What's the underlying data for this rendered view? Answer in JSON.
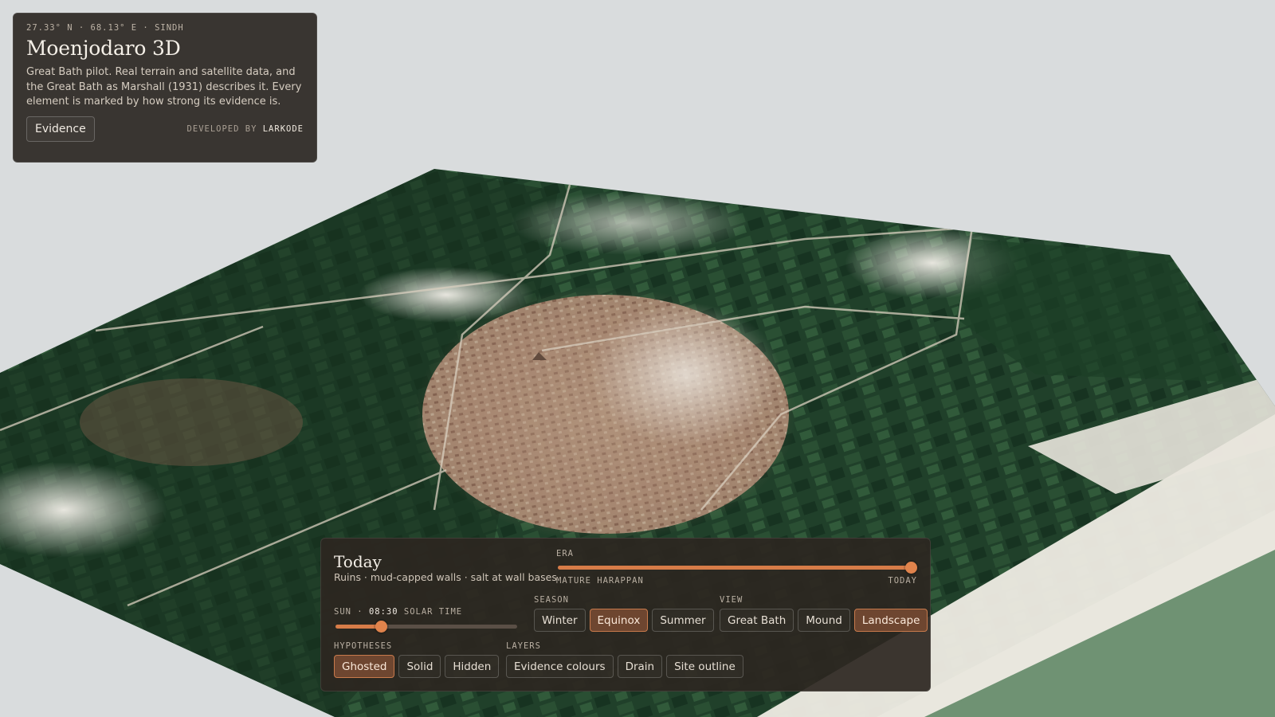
{
  "site": {
    "coordinates": "27.33° N · 68.13° E · SINDH",
    "title": "Moenjodaro 3D",
    "description": "Great Bath pilot. Real terrain and satellite data, and the Great Bath as Marshall (1931) describes it. Every element is marked by how strong its evidence is.",
    "evidence_label": "Evidence",
    "developed_by_label": "DEVELOPED BY",
    "developer": "LARKODE"
  },
  "era": {
    "name": "Today",
    "description": "Ruins · mud-capped walls · salt at wall bases",
    "label": "ERA",
    "start_label": "MATURE HARAPPAN",
    "end_label": "TODAY",
    "value": 1.0
  },
  "sun": {
    "label_prefix": "SUN ·",
    "time": "08:30",
    "label_suffix": "SOLAR TIME",
    "value": 0.25
  },
  "season": {
    "label": "SEASON",
    "options": [
      "Winter",
      "Equinox",
      "Summer"
    ],
    "selected": "Equinox"
  },
  "view": {
    "label": "VIEW",
    "options": [
      "Great Bath",
      "Mound",
      "Landscape"
    ],
    "selected": "Landscape"
  },
  "hypotheses": {
    "label": "HYPOTHESES",
    "options": [
      "Ghosted",
      "Solid",
      "Hidden"
    ],
    "selected": "Ghosted"
  },
  "layers": {
    "label": "LAYERS",
    "options": [
      "Evidence colours",
      "Drain",
      "Site outline"
    ]
  },
  "colors": {
    "accent": "#d77c48",
    "panel_bg": "#2c2621",
    "sky": "#d9dcdd",
    "vegetation": "#1f3a24",
    "soil": "#b89a82",
    "salt_flat": "#ece8df",
    "river": "#7f9e7e"
  }
}
